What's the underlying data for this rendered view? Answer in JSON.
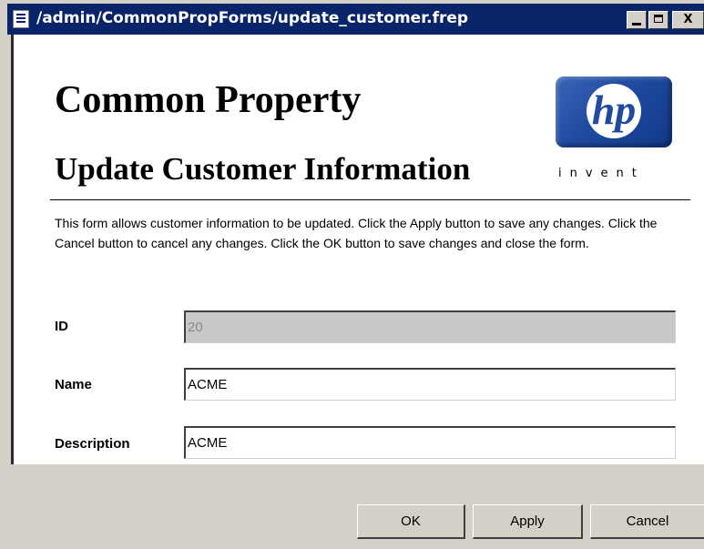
{
  "window": {
    "title": "/admin/CommonPropForms/update_customer.frep",
    "controls": {
      "minimize_icon": "minimize-icon",
      "maximize_icon": "maximize-icon",
      "close_icon": "close-icon",
      "close_label": "X"
    }
  },
  "header": {
    "title": "Common Property",
    "subtitle": "Update Customer Information",
    "logo": {
      "text": "hp",
      "tagline": "invent",
      "color": "#1f4aa0"
    }
  },
  "description": "This form allows customer information to be updated.  Click the Apply button to save any changes.  Click the Cancel button to cancel any changes.  Click the OK button to save changes and close the form.",
  "fields": [
    {
      "label": "ID",
      "value": "20",
      "disabled": true
    },
    {
      "label": "Name",
      "value": "ACME",
      "disabled": false
    },
    {
      "label": "Description",
      "value": "ACME",
      "disabled": false
    }
  ],
  "buttons": {
    "ok": "OK",
    "apply": "Apply",
    "cancel": "Cancel"
  },
  "colors": {
    "titlebar": "#0a246a",
    "chrome": "#d4d0c8",
    "disabled_field": "#c8c8c8"
  }
}
